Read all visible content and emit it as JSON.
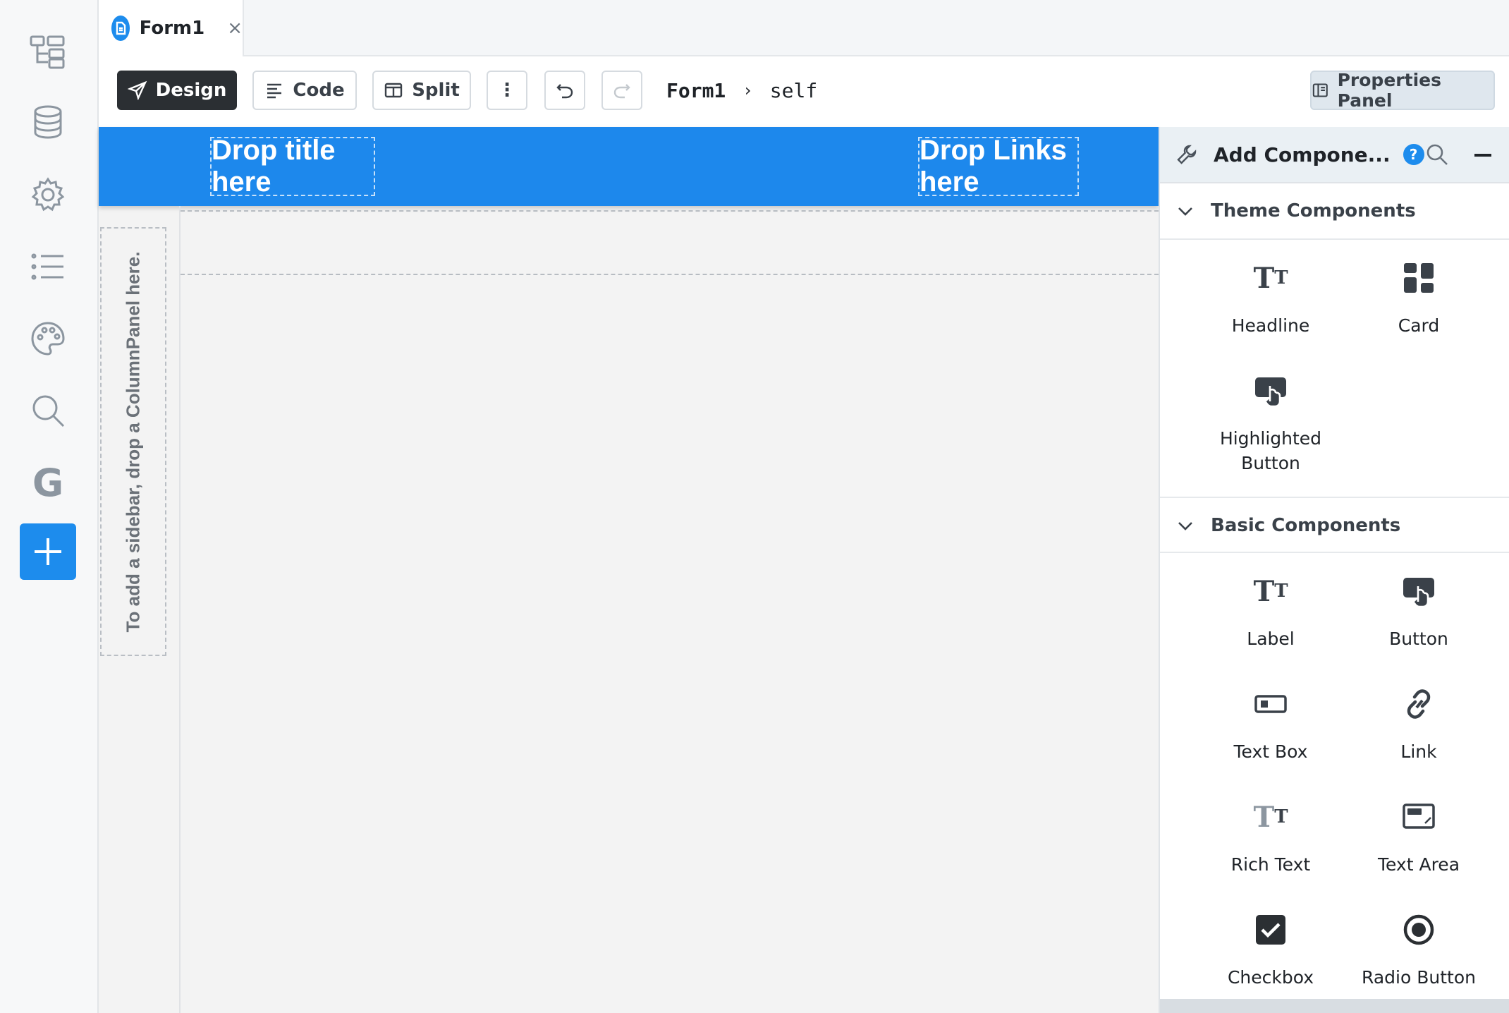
{
  "rail": {
    "items": [
      "app-structure",
      "data",
      "settings",
      "list",
      "theme",
      "search",
      "google",
      "add"
    ]
  },
  "tab": {
    "label": "Form1",
    "close": "×"
  },
  "toolbar": {
    "design_label": "Design",
    "code_label": "Code",
    "split_label": "Split",
    "more_label": "⋮",
    "breadcrumb_form": "Form1",
    "breadcrumb_sep": "›",
    "breadcrumb_self": "self",
    "properties_label": "Properties Panel"
  },
  "canvas": {
    "drop_title": "Drop title here",
    "drop_links": "Drop Links here",
    "sidebar_hint": "To add a sidebar, drop a ColumnPanel here."
  },
  "panel": {
    "title": "Add Compone...",
    "help": "?",
    "theme_section": "Theme Components",
    "theme_items": {
      "headline": "Headline",
      "card": "Card",
      "highlighted_button": "Highlighted Button"
    },
    "basic_section": "Basic Components",
    "basic_items": {
      "label": "Label",
      "button": "Button",
      "text_box": "Text Box",
      "link": "Link",
      "rich_text": "Rich Text",
      "text_area": "Text Area",
      "checkbox": "Checkbox",
      "radio_button": "Radio Button"
    }
  },
  "colors": {
    "accent": "#1d8ced",
    "header_blue": "#1d88ec",
    "dark_button": "#2b2f33"
  }
}
